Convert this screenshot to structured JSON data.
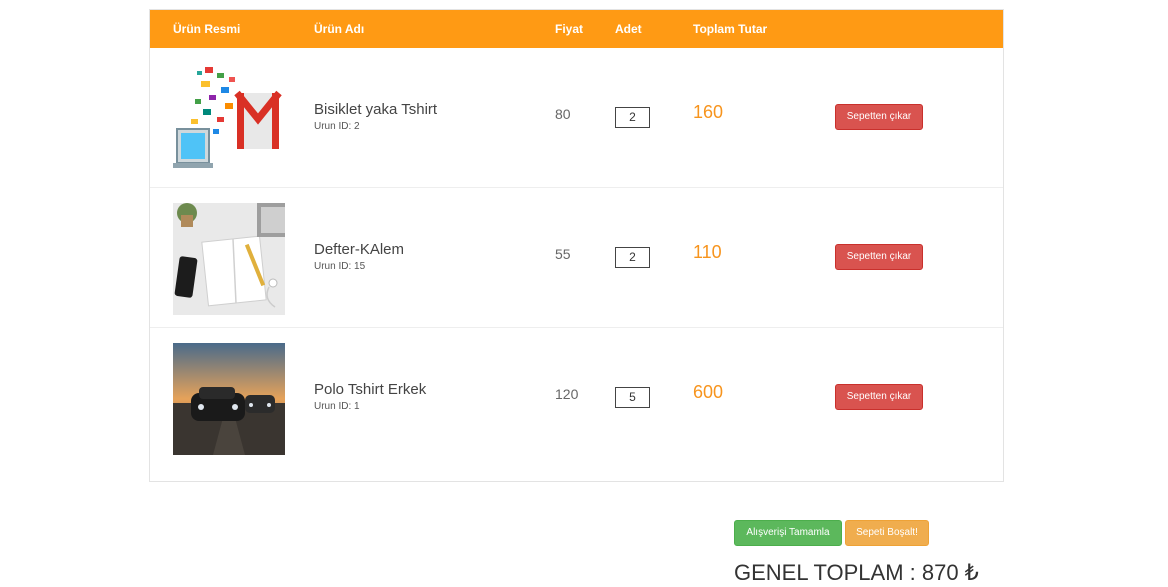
{
  "table": {
    "headers": {
      "image": "Ürün Resmi",
      "name": "Ürün Adı",
      "price": "Fiyat",
      "qty": "Adet",
      "total": "Toplam Tutar"
    }
  },
  "items": [
    {
      "name": "Bisiklet yaka Tshirt",
      "id_label": "Urun ID: 2",
      "price": "80",
      "qty": "2",
      "total": "160",
      "remove_label": "Sepetten çıkar"
    },
    {
      "name": "Defter-KAlem",
      "id_label": "Urun ID: 15",
      "price": "55",
      "qty": "2",
      "total": "110",
      "remove_label": "Sepetten çıkar"
    },
    {
      "name": "Polo Tshirt Erkek",
      "id_label": "Urun ID: 1",
      "price": "120",
      "qty": "5",
      "total": "600",
      "remove_label": "Sepetten çıkar"
    }
  ],
  "actions": {
    "complete_label": "Alışverişi Tamamla",
    "empty_label": "Sepeti Boşalt!"
  },
  "summary": {
    "grand_total_text": "GENEL TOPLAM : 870 ₺"
  },
  "colors": {
    "header": "#ff9a14",
    "total_text": "#f7941d",
    "remove_button": "#d9534f",
    "complete_button": "#5cb85c",
    "empty_button": "#f0ad4e"
  }
}
